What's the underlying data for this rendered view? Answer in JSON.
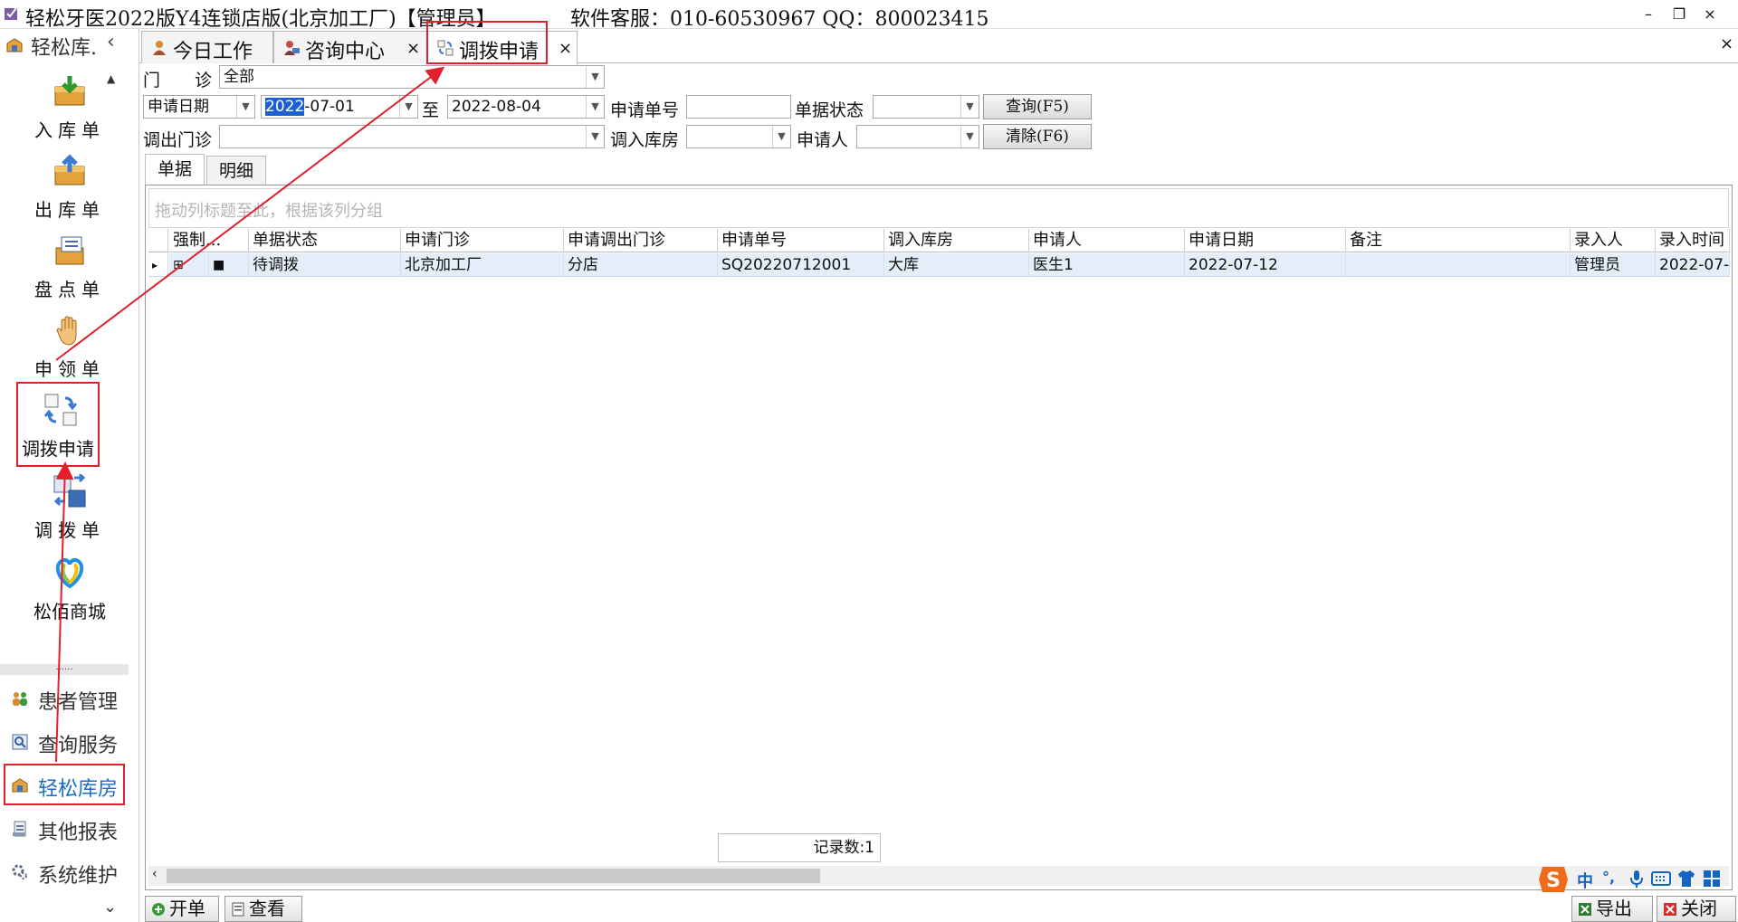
{
  "window": {
    "title": "轻松牙医2022版Y4连锁店版(北京加工厂)【管理员】",
    "service": "软件客服：010-60530967 QQ：800023415",
    "min": "–",
    "restore": "❐",
    "close": "×"
  },
  "sidebar": {
    "header": "轻松库.",
    "collapse": "‹",
    "scroll_up": "▲",
    "scroll_down": "⌄",
    "separator": "......",
    "tools": [
      {
        "label": "入库单"
      },
      {
        "label": "出库单"
      },
      {
        "label": "盘点单"
      },
      {
        "label": "申领单"
      },
      {
        "label": "调拨申请"
      },
      {
        "label": "调拨单"
      },
      {
        "label": "松佰商城"
      }
    ],
    "nav": [
      {
        "label": "患者管理"
      },
      {
        "label": "查询服务"
      },
      {
        "label": "轻松库房"
      },
      {
        "label": "其他报表"
      },
      {
        "label": "系统维护"
      }
    ]
  },
  "tabs": [
    {
      "label": "今日工作"
    },
    {
      "label": "咨询中心",
      "close": "×"
    },
    {
      "label": "调拨申请",
      "close": "×"
    }
  ],
  "tabs_close_all": "×",
  "form": {
    "clinic_label": "门　　诊",
    "clinic_value": "全部",
    "date_type": "申请日期",
    "date_from_year": "2022",
    "date_from_rest": "-07-01",
    "to_label": "至",
    "date_to": "2022-08-04",
    "apply_no_label": "申请单号",
    "apply_no_value": "",
    "status_label": "单据状态",
    "status_value": "",
    "query_button": "查询(F5)",
    "out_clinic_label": "调出门诊",
    "out_clinic_value": "",
    "in_store_label": "调入库房",
    "in_store_value": "",
    "applicant_label": "申请人",
    "applicant_value": "",
    "clear_button": "清除(F6)"
  },
  "inner_tabs": [
    {
      "label": "单据"
    },
    {
      "label": "明细"
    }
  ],
  "grid": {
    "group_hint": "拖动列标题至此，根据该列分组",
    "columns": [
      "强制...",
      "单据状态",
      "申请门诊",
      "申请调出门诊",
      "申请单号",
      "调入库房",
      "申请人",
      "申请日期",
      "备注",
      "录入人",
      "录入时间"
    ],
    "rows": [
      {
        "expand": "⊞",
        "force": "■",
        "status": "待调拨",
        "clinic": "北京加工厂",
        "out_clinic": "分店",
        "apply_no": "SQ20220712001",
        "in_store": "大库",
        "applicant": "医生1",
        "apply_date": "2022-07-12",
        "remark": "",
        "creator": "管理员",
        "create_time": "2022-07-"
      }
    ],
    "record_count": "记录数:1",
    "row_indicator": "▸",
    "scroll_left": "‹"
  },
  "bottom": {
    "open_button": "开单",
    "view_button": "查看",
    "export_button": "导出",
    "close_button": "关闭"
  },
  "ime": {
    "items": [
      "中",
      "°,",
      "🎤",
      "⌨",
      "👕",
      "▦"
    ]
  },
  "colors": {
    "highlight_red": "#e0202a",
    "selection_blue": "#1c5fd1",
    "row_bg": "#e4eef9",
    "active_nav": "#1a6cc8"
  }
}
